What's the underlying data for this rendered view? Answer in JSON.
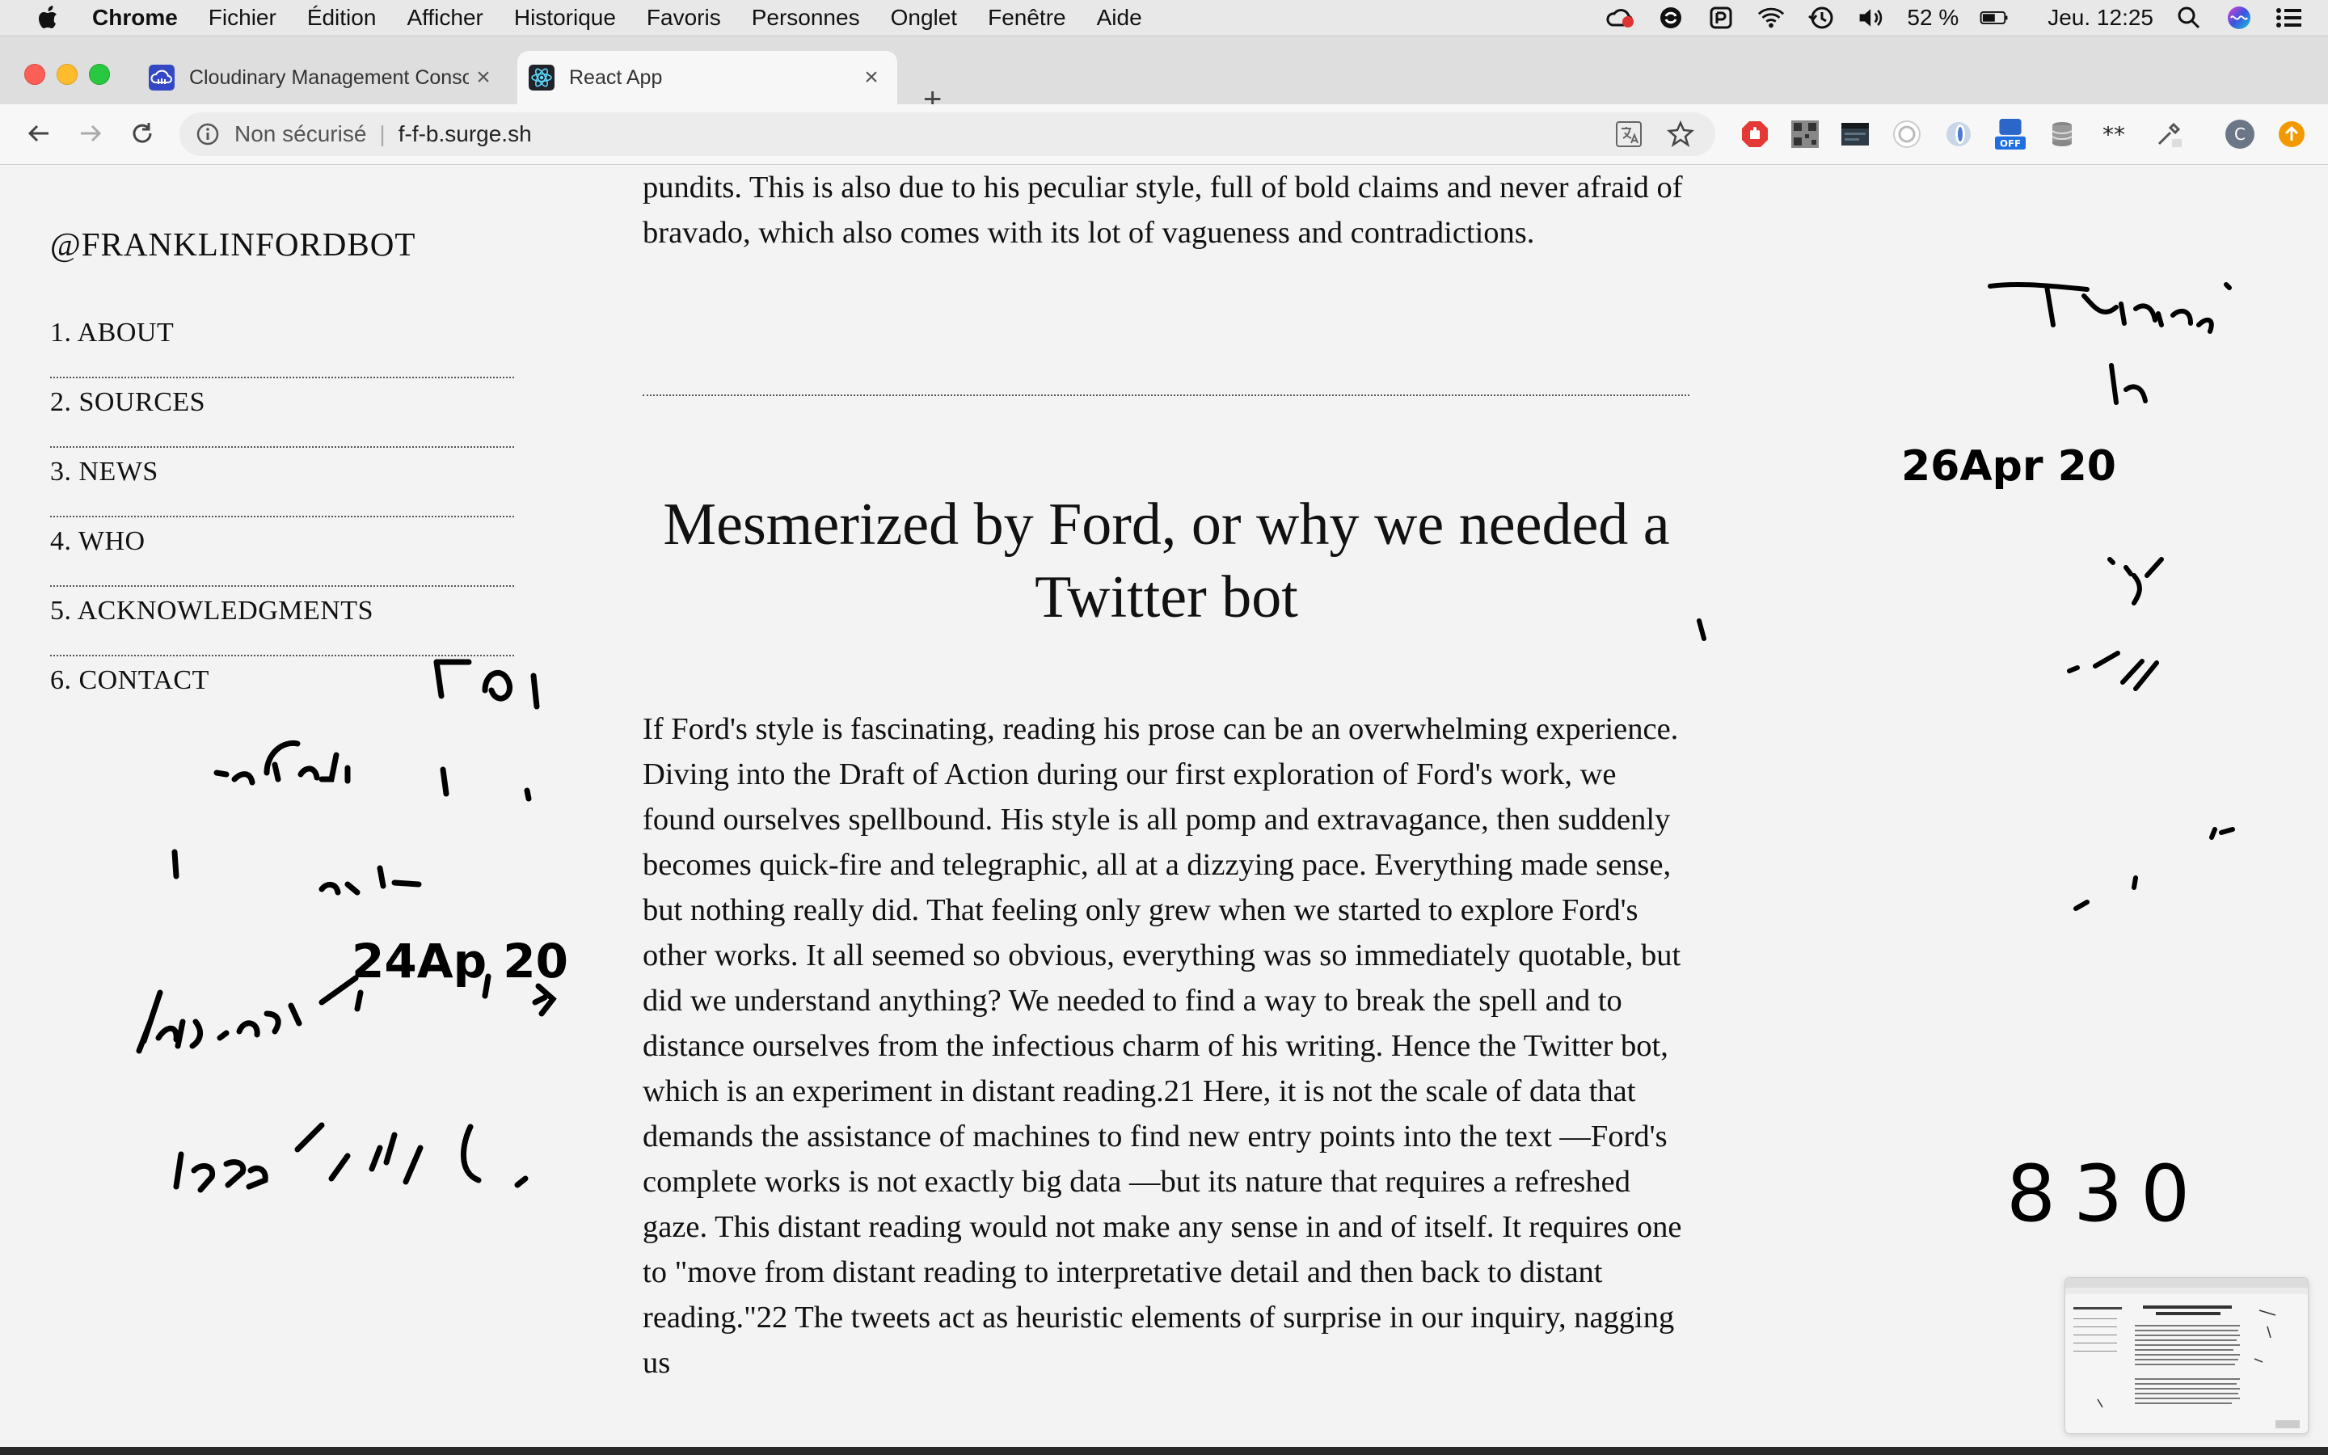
{
  "menubar": {
    "items": [
      "Chrome",
      "Fichier",
      "Édition",
      "Afficher",
      "Historique",
      "Favoris",
      "Personnes",
      "Onglet",
      "Fenêtre",
      "Aide"
    ],
    "battery": "52 %",
    "clock": "Jeu. 12:25"
  },
  "tabs": [
    {
      "title": "Cloudinary Management Conso",
      "close": "×"
    },
    {
      "title": "React App",
      "close": "×"
    }
  ],
  "new_tab": "+",
  "toolbar": {
    "security_label": "Non sécurisé",
    "separator": "|",
    "url": "f-f-b.surge.sh",
    "ext_badge": "OFF",
    "profile_initial": "C"
  },
  "site": {
    "brand": "@FRANKLINFORDBOT",
    "nav": [
      "1. ABOUT",
      "2. SOURCES",
      "3. NEWS",
      "4. WHO",
      "5. ACKNOWLEDGMENTS",
      "6. CONTACT"
    ]
  },
  "article": {
    "top_paragraph": "pundits. This is also due to his peculiar style, full of bold claims and never afraid of bravado, which also comes with its lot of vagueness and contradictions.",
    "heading": "Mesmerized by Ford, or why we needed a Twitter bot",
    "body": "If Ford's style is fascinating, reading his prose can be an overwhelming experience. Diving into the Draft of Action during our first exploration of Ford's work, we found ourselves spellbound. His style is all pomp and extravagance, then suddenly becomes quick-fire and telegraphic, all at a dizzying pace. Everything made sense, but nothing really did. That feeling only grew when we started to explore Ford's other works. It all seemed so obvious, everything was so immediately quotable, but did we understand anything? We needed to find a way to break the spell and to distance ourselves from the infectious charm of his writing. Hence the Twitter bot, which is an experiment in distant reading.21 Here, it is not the scale of data that demands the assistance of machines to find new entry points into the text —Ford's complete works is not exactly big data —but its nature that requires a refreshed gaze. This distant reading would not make any sense in and of itself. It requires one to \"move from distant reading to interpretative detail and then back to distant reading.\"22 The tweets act as heuristic elements of surprise in our inquiry, nagging us"
  },
  "scribbles": {
    "left_date": "24Ap 20",
    "right_date": "26Apr 20",
    "right_number": "830",
    "right_top": "Tontine"
  },
  "colors": {
    "accent_react": "#61dafb",
    "chrome_tab_active": "#f7f7f7",
    "page_bg": "#f3f3f3"
  }
}
